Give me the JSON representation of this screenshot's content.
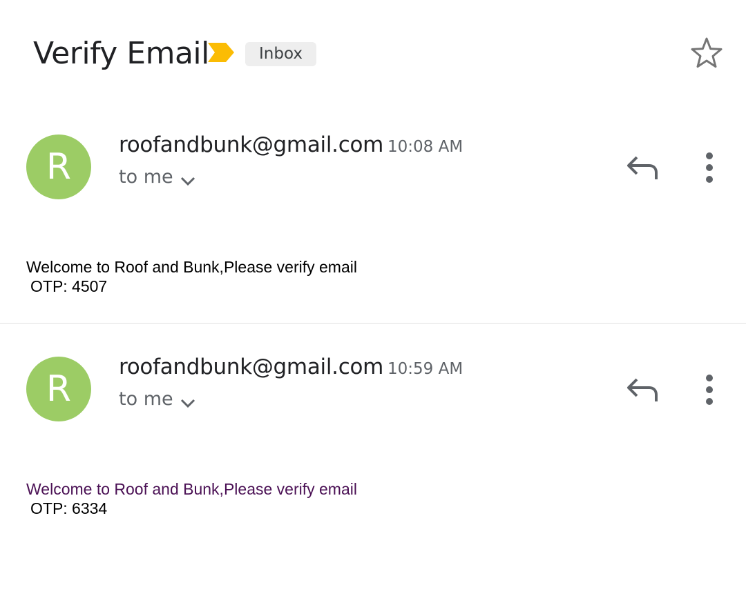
{
  "header": {
    "subject": "Verify Email",
    "label": "Inbox",
    "importance_icon": "importance-marker-icon",
    "star_icon": "star-outline-icon"
  },
  "colors": {
    "avatar_bg": "#9ccc65",
    "importance": "#fbbc04",
    "visited_text": "#4a1054"
  },
  "messages": [
    {
      "avatar_letter": "R",
      "sender": "roofandbunk@gmail.com",
      "time": "10:08 AM",
      "recipient": "to me",
      "body_line1": "Welcome to Roof and Bunk,Please verify email",
      "body_line2": "OTP: 4507"
    },
    {
      "avatar_letter": "R",
      "sender": "roofandbunk@gmail.com",
      "time": "10:59 AM",
      "recipient": "to me",
      "body_line1": "Welcome to Roof and Bunk,Please verify email",
      "body_line2": "OTP: 6334"
    }
  ]
}
